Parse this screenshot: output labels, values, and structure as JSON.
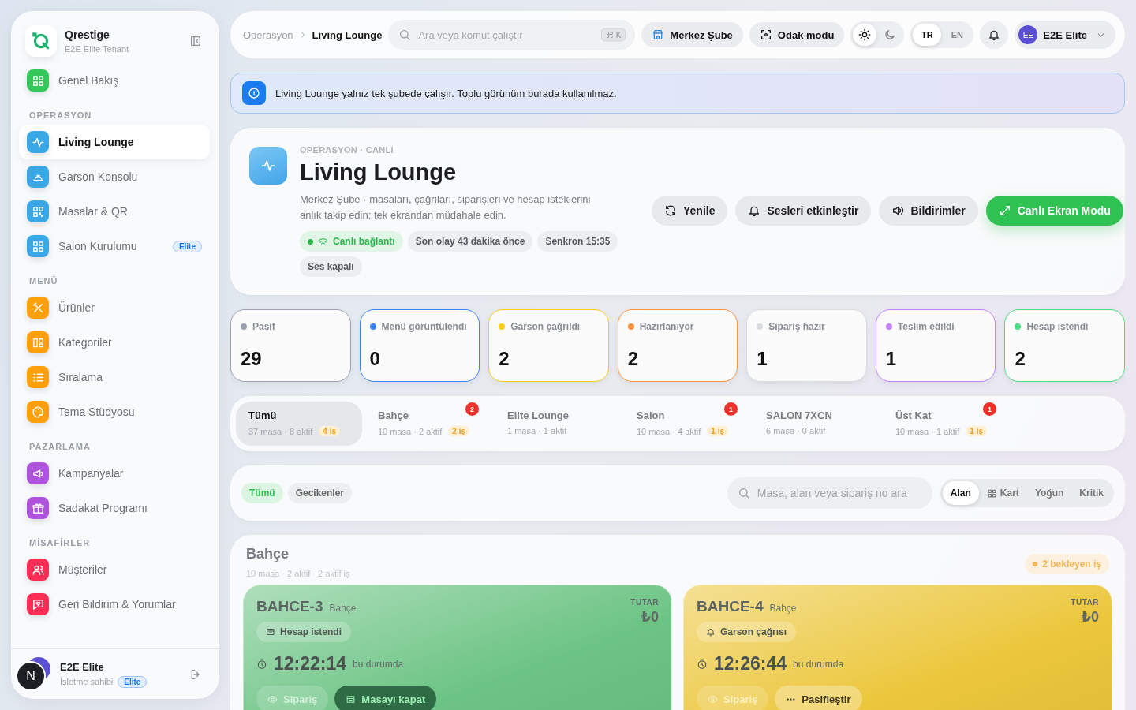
{
  "sidebar": {
    "brand": {
      "name": "Qrestige",
      "tenant": "E2E Elite Tenant"
    },
    "sections": [
      {
        "items": [
          {
            "label": "Genel Bakış",
            "color": "#34c759",
            "selected": false
          }
        ]
      },
      {
        "heading": "OPERASYON",
        "items": [
          {
            "label": "Living Lounge",
            "color": "#3aa8e6",
            "selected": true
          },
          {
            "label": "Garson Konsolu",
            "color": "#3aa8e6",
            "selected": false
          },
          {
            "label": "Masalar & QR",
            "color": "#3aa8e6",
            "selected": false
          },
          {
            "label": "Salon Kurulumu",
            "color": "#3aa8e6",
            "selected": false,
            "badge": "Elite"
          }
        ]
      },
      {
        "heading": "MENÜ",
        "items": [
          {
            "label": "Ürünler",
            "color": "#ff9f0a",
            "selected": false
          },
          {
            "label": "Kategoriler",
            "color": "#ff9f0a",
            "selected": false
          },
          {
            "label": "Sıralama",
            "color": "#ff9f0a",
            "selected": false
          },
          {
            "label": "Tema Stüdyosu",
            "color": "#ff9f0a",
            "selected": false
          }
        ]
      },
      {
        "heading": "PAZARLAMA",
        "items": [
          {
            "label": "Kampanyalar",
            "color": "#af52de",
            "selected": false
          },
          {
            "label": "Sadakat Programı",
            "color": "#af52de",
            "selected": false
          }
        ]
      },
      {
        "heading": "MİSAFİRLER",
        "items": [
          {
            "label": "Müşteriler",
            "color": "#ff2d55",
            "selected": false
          },
          {
            "label": "Geri Bildirim & Yorumlar",
            "color": "#ff2d55",
            "selected": false
          }
        ]
      }
    ],
    "user": {
      "avatar": "N",
      "name": "E2E Elite",
      "role": "İşletme sahibi",
      "badge": "Elite"
    }
  },
  "topbar": {
    "breadcrumb": [
      "Operasyon",
      "Living Lounge"
    ],
    "search": {
      "placeholder": "Ara veya komut çalıştır",
      "shortcut": "⌘ K"
    },
    "branch": "Merkez Şube",
    "focus": "Odak modu",
    "themes": [
      {
        "kind": "light",
        "selected": true
      },
      {
        "kind": "dark",
        "selected": false
      }
    ],
    "languages": [
      {
        "label": "TR",
        "selected": true
      },
      {
        "label": "EN",
        "selected": false
      }
    ],
    "user": {
      "initials": "EE",
      "name": "E2E Elite"
    }
  },
  "notice": "Living Lounge yalnız tek şubede çalışır. Toplu görünüm burada kullanılmaz.",
  "hero": {
    "eyebrow": "OPERASYON · CANLI",
    "title": "Living Lounge",
    "description": "Merkez Şube · masaları, çağrıları, siparişleri ve hesap isteklerini anlık takip edin; tek ekrandan müdahale edin.",
    "chips": [
      {
        "label": "Canlı bağlantı",
        "kind": "live"
      },
      {
        "label": "Son olay 43 dakika önce",
        "kind": "plain"
      },
      {
        "label": "Senkron 15:35",
        "kind": "plain"
      },
      {
        "label": "Ses kapalı",
        "kind": "plain"
      }
    ],
    "actions": [
      {
        "label": "Yenile",
        "primary": false
      },
      {
        "label": "Sesleri etkinleştir",
        "primary": false
      },
      {
        "label": "Bildirimler",
        "primary": false
      },
      {
        "label": "Canlı Ekran Modu",
        "primary": true
      }
    ]
  },
  "stats": [
    {
      "label": "Pasif",
      "color": "#9ca3af",
      "count": "29"
    },
    {
      "label": "Menü görüntülendi",
      "color": "#3b82f6",
      "count": "0"
    },
    {
      "label": "Garson çağrıldı",
      "color": "#facc15",
      "count": "2"
    },
    {
      "label": "Hazırlanıyor",
      "color": "#fb923c",
      "count": "2"
    },
    {
      "label": "Sipariş hazır",
      "color": "#d9dce1",
      "count": "1"
    },
    {
      "label": "Teslim edildi",
      "color": "#c084fc",
      "count": "1"
    },
    {
      "label": "Hesap istendi",
      "color": "#4ade80",
      "count": "2"
    }
  ],
  "areas": [
    {
      "name": "Tümü",
      "meta": "37 masa · 8 aktif",
      "jobs": "4 iş",
      "selected": true
    },
    {
      "name": "Bahçe",
      "meta": "10 masa · 2 aktif",
      "jobs": "2 iş",
      "alert": "2",
      "selected": false
    },
    {
      "name": "Elite Lounge",
      "meta": "1 masa · 1 aktif",
      "selected": false
    },
    {
      "name": "Salon",
      "meta": "10 masa · 4 aktif",
      "jobs": "1 iş",
      "alert": "1",
      "selected": false
    },
    {
      "name": "SALON 7XCN",
      "meta": "6 masa · 0 aktif",
      "selected": false
    },
    {
      "name": "Üst Kat",
      "meta": "10 masa · 1 aktif",
      "jobs": "1 iş",
      "alert": "1",
      "selected": false
    }
  ],
  "filters": {
    "chips": [
      {
        "label": "Tümü",
        "selected": true
      },
      {
        "label": "Gecikenler",
        "selected": false
      }
    ],
    "search": {
      "placeholder": "Masa, alan veya sipariş no ara"
    },
    "views": [
      {
        "label": "Alan",
        "selected": true
      },
      {
        "label": "Kart",
        "selected": false
      },
      {
        "label": "Yoğun",
        "selected": false
      },
      {
        "label": "Kritik",
        "selected": false
      }
    ]
  },
  "section": {
    "title": "Bahçe",
    "summary": "10 masa · 2 aktif · 2 aktif iş",
    "pending": "2 bekleyen iş",
    "tables": [
      {
        "code": "BAHCE-3",
        "area": "Bahçe",
        "total_label": "TUTAR",
        "total": "₺0",
        "color": "#6cc484",
        "status": {
          "label": "Hesap istendi",
          "kind": "bill"
        },
        "timer": "12:22:14",
        "timer_note": "bu durumda",
        "actions": [
          {
            "label": "Sipariş",
            "kind": "ghost"
          },
          {
            "label": "Masayı kapat",
            "kind": "dark"
          }
        ]
      },
      {
        "code": "BAHCE-4",
        "area": "Bahçe",
        "total_label": "TUTAR",
        "total": "₺0",
        "color": "#ecc73c",
        "status": {
          "label": "Garson çağrısı",
          "kind": "call"
        },
        "timer": "12:26:44",
        "timer_note": "bu durumda",
        "actions": [
          {
            "label": "Sipariş",
            "kind": "ghost"
          },
          {
            "label": "Pasifleştir",
            "kind": "chip"
          }
        ]
      }
    ]
  }
}
